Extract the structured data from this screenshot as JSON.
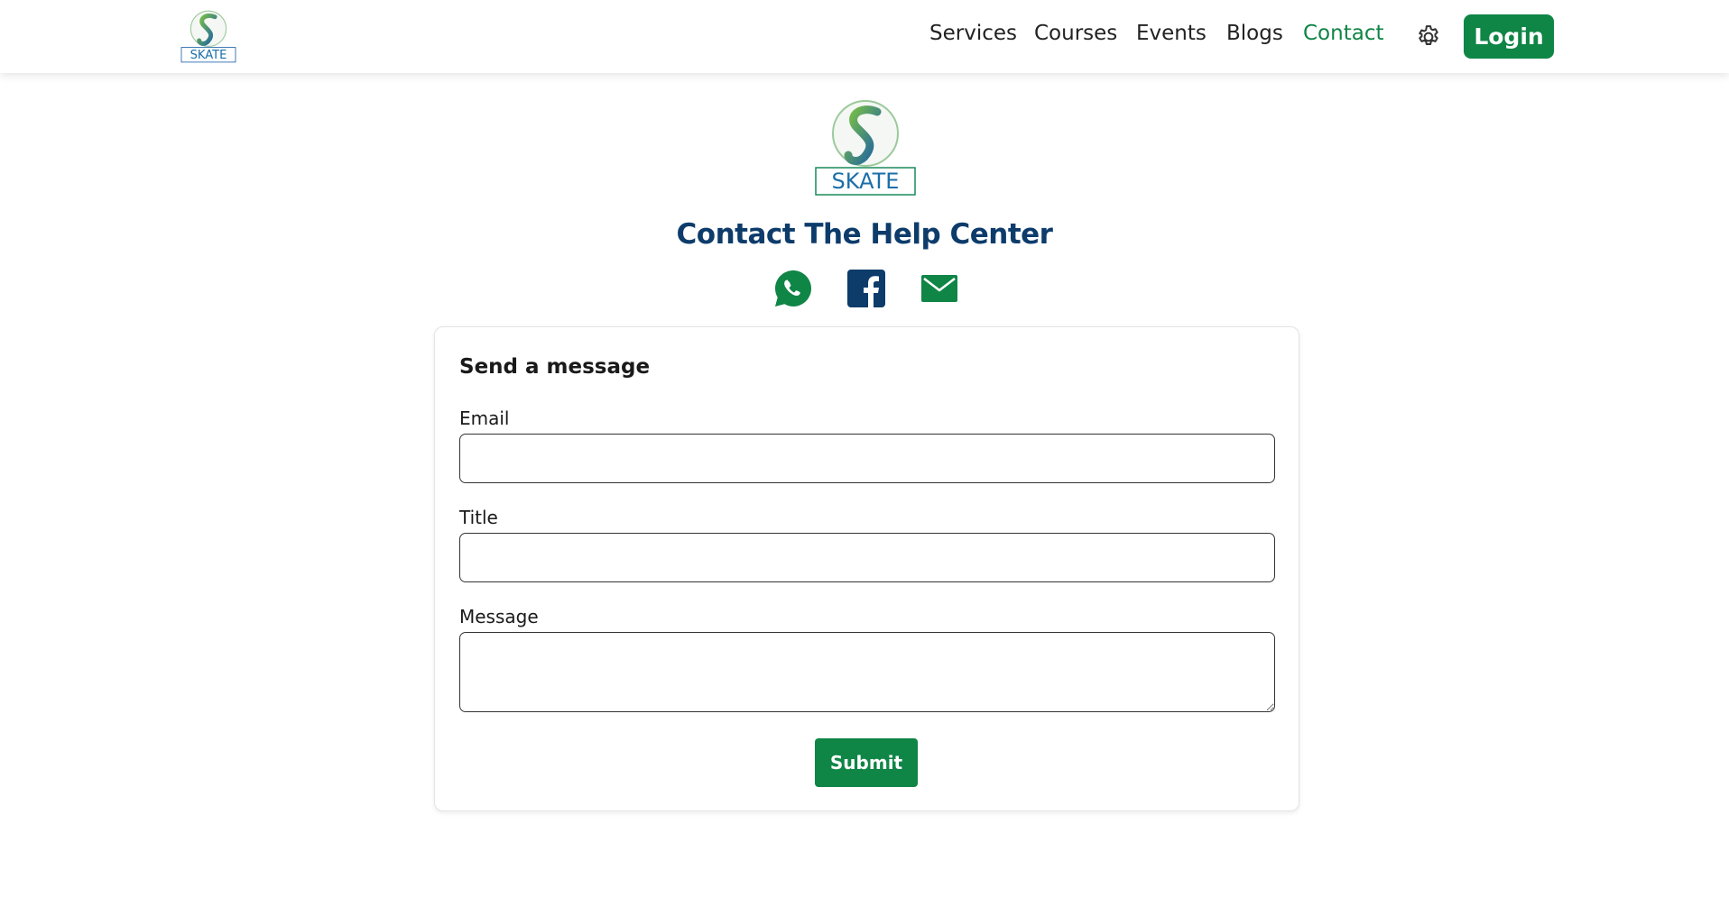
{
  "brand": {
    "logo_text": "SKATE"
  },
  "nav": {
    "items": [
      {
        "label": "Services",
        "active": false
      },
      {
        "label": "Courses",
        "active": false
      },
      {
        "label": "Events",
        "active": false
      },
      {
        "label": "Blogs",
        "active": false
      },
      {
        "label": "Contact",
        "active": true
      }
    ],
    "settings_icon": "gear-icon",
    "login_label": "Login"
  },
  "page": {
    "title": "Contact The Help Center"
  },
  "social": [
    {
      "icon": "whatsapp-icon",
      "color": "#0f8546"
    },
    {
      "icon": "facebook-icon",
      "color": "#0d3c6b"
    },
    {
      "icon": "mail-icon",
      "color": "#0f8546"
    }
  ],
  "form": {
    "title": "Send a message",
    "email_label": "Email",
    "email_value": "",
    "title_label": "Title",
    "title_value": "",
    "message_label": "Message",
    "message_value": "",
    "submit_label": "Submit"
  },
  "colors": {
    "brand_green": "#0f8546",
    "brand_navy": "#0d3c6b"
  }
}
